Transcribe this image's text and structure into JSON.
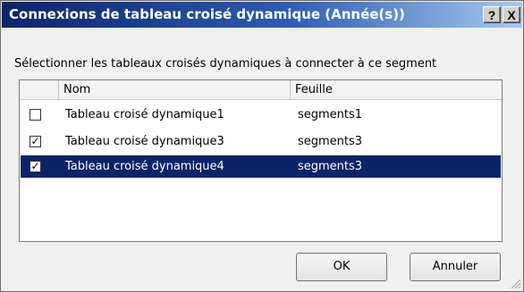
{
  "window": {
    "title": "Connexions de tableau croisé dynamique (Année(s))",
    "help_glyph": "?",
    "close_glyph": "X"
  },
  "instruction": "Sélectionner les tableaux croisés dynamiques à connecter à ce segment",
  "table": {
    "columns": [
      "",
      "Nom",
      "Feuille"
    ],
    "rows": [
      {
        "checked": false,
        "check_glyph": "",
        "name": "Tableau croisé dynamique1",
        "sheet": "segments1",
        "selected": false
      },
      {
        "checked": true,
        "check_glyph": "✓",
        "name": "Tableau croisé dynamique3",
        "sheet": "segments3",
        "selected": false
      },
      {
        "checked": true,
        "check_glyph": "✓",
        "name": "Tableau croisé dynamique4",
        "sheet": "segments3",
        "selected": true
      }
    ]
  },
  "buttons": {
    "ok": "OK",
    "cancel": "Annuler"
  },
  "colors": {
    "title_bar_start": "#0a246a",
    "title_bar_end": "#a6caf0",
    "selection": "#0a246a",
    "dialog_bg": "#f0f0f0"
  },
  "icons": {
    "help": "help-icon",
    "close": "close-icon",
    "grip": "resize-grip-icon",
    "checkbox": "checkbox-icon"
  }
}
